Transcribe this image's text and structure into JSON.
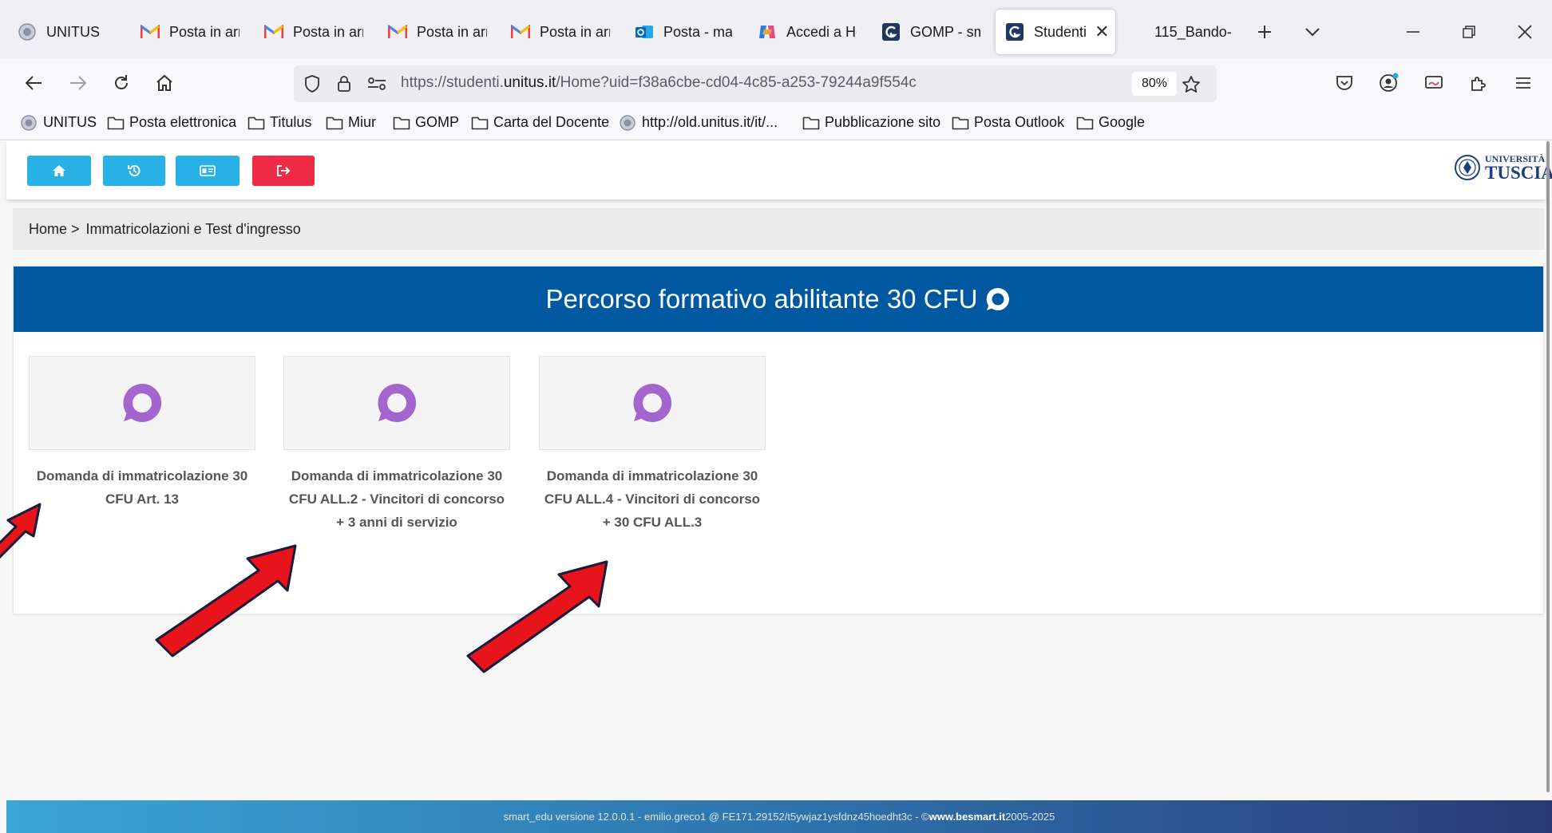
{
  "browser": {
    "tabs": [
      {
        "label": "UNITUS",
        "icon": "unitus-seal-icon"
      },
      {
        "label": "Posta in arri",
        "icon": "gmail-icon"
      },
      {
        "label": "Posta in arri",
        "icon": "gmail-icon"
      },
      {
        "label": "Posta in arri",
        "icon": "gmail-icon"
      },
      {
        "label": "Posta in arri",
        "icon": "gmail-icon"
      },
      {
        "label": "Posta - mar",
        "icon": "outlook-icon"
      },
      {
        "label": "Accedi a Ho",
        "icon": "copilot-icon"
      },
      {
        "label": "GOMP - sm",
        "icon": "gomp-icon"
      },
      {
        "label": "Studenti",
        "icon": "gomp-icon",
        "active": true
      },
      {
        "label": "115_Bando-",
        "icon": ""
      }
    ],
    "url": {
      "prefix": "https://studenti.",
      "domain": "unitus.it",
      "path": "/Home?uid=f38a6cbe-cd04-4c85-a253-79244a9f554c"
    },
    "zoom": "80%",
    "bookmarks": [
      {
        "label": "UNITUS",
        "icon": "unitus-seal-icon"
      },
      {
        "label": "Posta elettronica",
        "icon": "folder-icon"
      },
      {
        "label": "Titulus",
        "icon": "folder-icon"
      },
      {
        "label": "Miur",
        "icon": "folder-icon"
      },
      {
        "label": "GOMP",
        "icon": "folder-icon"
      },
      {
        "label": "Carta del Docente",
        "icon": "folder-icon"
      },
      {
        "label": "http://old.unitus.it/it/...",
        "icon": "unitus-seal-icon"
      },
      {
        "label": "Pubblicazione sito",
        "icon": "folder-icon"
      },
      {
        "label": "Posta Outlook",
        "icon": "folder-icon"
      },
      {
        "label": "Google",
        "icon": "folder-icon"
      }
    ]
  },
  "header": {
    "buttons": [
      {
        "icon": "home-icon",
        "color": "#27b1e6"
      },
      {
        "icon": "history-icon",
        "color": "#27b1e6"
      },
      {
        "icon": "id-card-icon",
        "color": "#27b1e6"
      },
      {
        "icon": "sign-out-icon",
        "color": "#ef2b45"
      }
    ],
    "logo": {
      "line1": "UNIVERSITÀ",
      "line2": "TUSCIA"
    }
  },
  "breadcrumb": {
    "home": "Home",
    "separator": ">",
    "current": "Immatricolazioni e Test d'ingresso"
  },
  "panel": {
    "title": "Percorso formativo abilitante 30 CFU",
    "accent_color": "#0059a0",
    "icon_color": "#a465cf",
    "cards": [
      {
        "line1": "Domanda di immatricolazione 30",
        "line2": "CFU Art. 13",
        "line3": ""
      },
      {
        "line1": "Domanda di immatricolazione 30",
        "line2": "CFU ALL.2 - Vincitori di concorso",
        "line3": "+ 3 anni di servizio"
      },
      {
        "line1": "Domanda di immatricolazione 30",
        "line2": "CFU ALL.4 - Vincitori di concorso",
        "line3": "+ 30 CFU ALL.3"
      }
    ]
  },
  "footer": {
    "text": "smart_edu versione 12.0.0.1 - emilio.greco1 @ FE171.29152/t5ywjaz1ysfdnz45hoedht3c - © ",
    "link": "www.besmart.it",
    "years": " 2005-2025"
  },
  "annotations": {
    "arrow_color": "#e8141b"
  }
}
